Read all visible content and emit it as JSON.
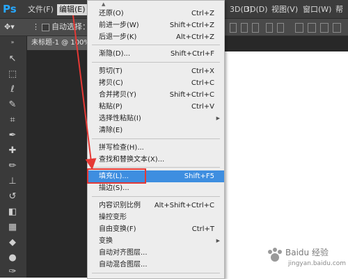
{
  "menubar": {
    "logo": "Ps",
    "items": [
      {
        "label": "文件(F)"
      },
      {
        "label": "编辑(E)"
      },
      {
        "label": "3D(D)"
      },
      {
        "label": "3D(D)"
      },
      {
        "label": "视图(V)"
      },
      {
        "label": "窗口(W)"
      },
      {
        "label": "帮"
      }
    ]
  },
  "toolbar": {
    "auto_select_label": "自动选择："
  },
  "document": {
    "tab_title": "未标题-1 @ 100%"
  },
  "edit_menu": {
    "items": [
      {
        "label": "还原(O)",
        "shortcut": "Ctrl+Z"
      },
      {
        "label": "前进一步(W)",
        "shortcut": "Shift+Ctrl+Z"
      },
      {
        "label": "后退一步(K)",
        "shortcut": "Alt+Ctrl+Z"
      },
      {
        "label": "渐隐(D)...",
        "shortcut": "Shift+Ctrl+F"
      },
      {
        "label": "剪切(T)",
        "shortcut": "Ctrl+X"
      },
      {
        "label": "拷贝(C)",
        "shortcut": "Ctrl+C"
      },
      {
        "label": "合并拷贝(Y)",
        "shortcut": "Shift+Ctrl+C"
      },
      {
        "label": "粘贴(P)",
        "shortcut": "Ctrl+V"
      },
      {
        "label": "选择性粘贴(I)",
        "shortcut": ""
      },
      {
        "label": "清除(E)",
        "shortcut": ""
      },
      {
        "label": "拼写检查(H)...",
        "shortcut": ""
      },
      {
        "label": "查找和替换文本(X)...",
        "shortcut": ""
      },
      {
        "label": "填充(L)...",
        "shortcut": "Shift+F5"
      },
      {
        "label": "描边(S)...",
        "shortcut": ""
      },
      {
        "label": "内容识别比例",
        "shortcut": "Alt+Shift+Ctrl+C"
      },
      {
        "label": "操控变形",
        "shortcut": ""
      },
      {
        "label": "自由变换(F)",
        "shortcut": "Ctrl+T"
      },
      {
        "label": "变换",
        "shortcut": ""
      },
      {
        "label": "自动对齐图层...",
        "shortcut": ""
      },
      {
        "label": "自动混合图层...",
        "shortcut": ""
      }
    ]
  },
  "watermark": {
    "text": "Baidu 经验",
    "url": "jingyan.baidu.com"
  },
  "colors": {
    "highlight": "#3e8ee0",
    "annotation": "#e53935",
    "ps_blue": "#27a8ff"
  },
  "icons": [
    "move-tool-icon",
    "marquee-tool-icon",
    "lasso-tool-icon",
    "quick-select-icon",
    "crop-tool-icon",
    "eyedropper-icon",
    "healing-brush-icon",
    "brush-tool-icon",
    "clone-stamp-icon",
    "history-brush-icon",
    "eraser-icon",
    "gradient-icon",
    "blur-icon",
    "dodge-icon",
    "pen-tool-icon"
  ]
}
